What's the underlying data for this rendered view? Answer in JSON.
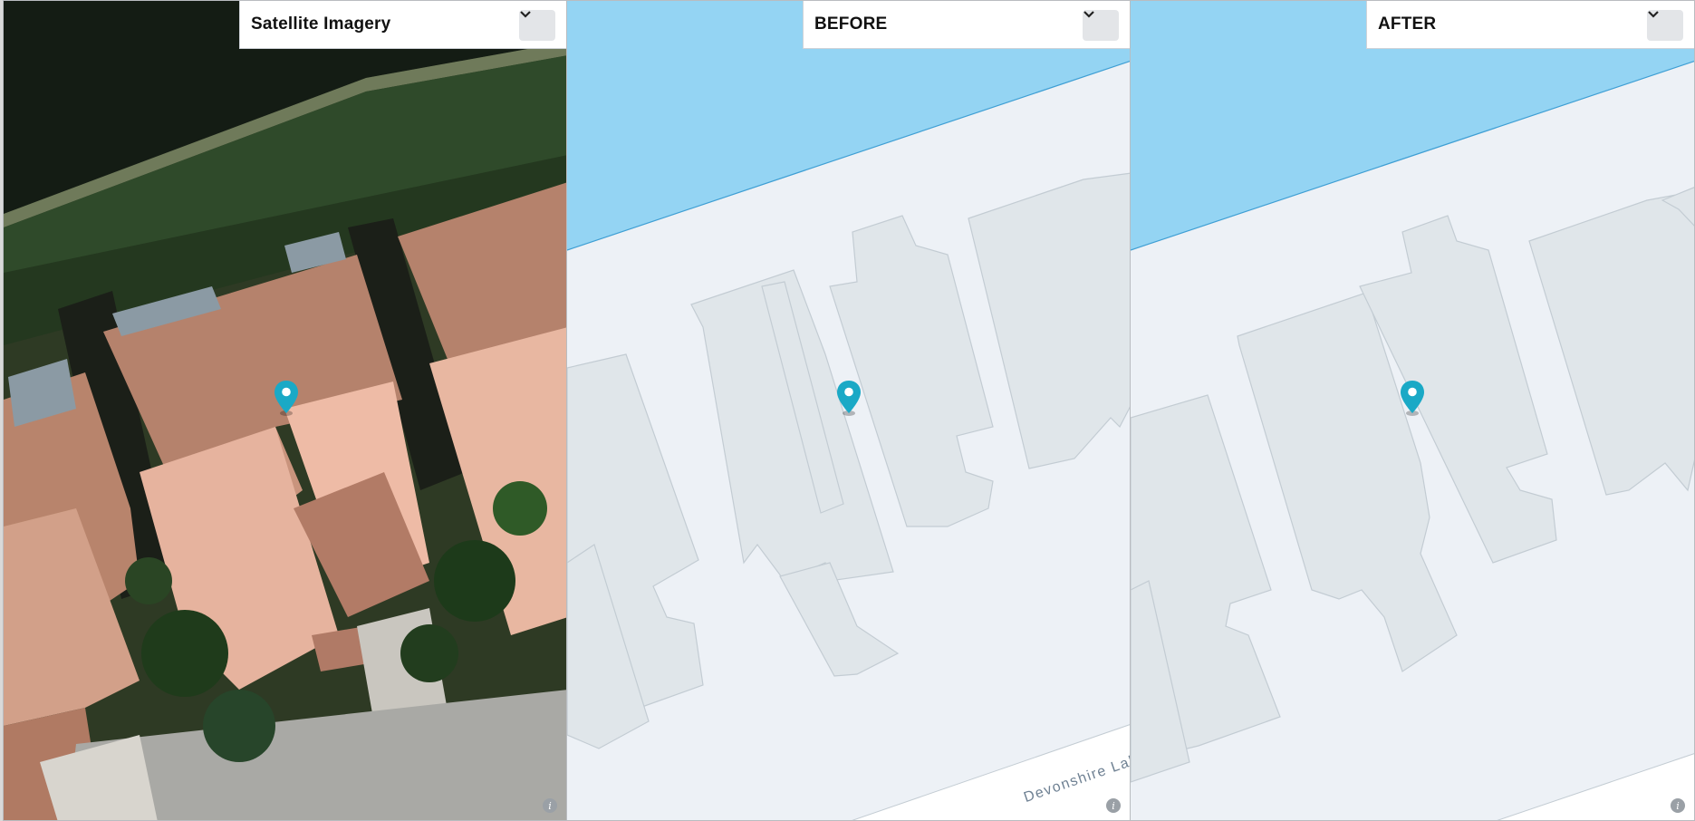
{
  "panels": [
    {
      "selected_layer": "Satellite Imagery",
      "info_label": "i"
    },
    {
      "selected_layer": "BEFORE",
      "info_label": "i",
      "street_label": "Devonshire Lake"
    },
    {
      "selected_layer": "AFTER",
      "info_label": "i"
    }
  ],
  "icons": {
    "marker": "map-pin-icon",
    "dropdown": "chevron-down-icon",
    "info": "info-icon"
  },
  "colors": {
    "water": "#94d4f3",
    "land": "#edf1f6",
    "building": "#e0e6ea",
    "building_edge": "#c3ccd3",
    "pin": "#1aa9c6",
    "roof": "#b7856f"
  }
}
